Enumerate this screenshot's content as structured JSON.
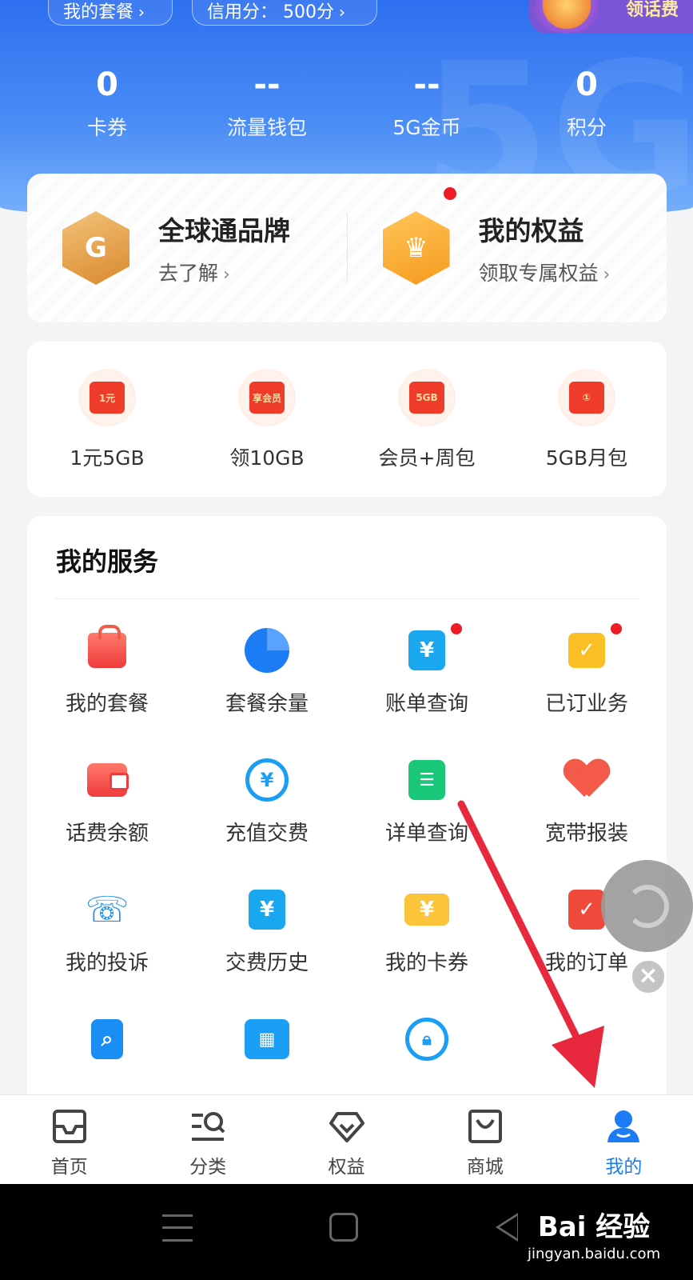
{
  "header": {
    "my_plan": "我的套餐",
    "credit": "信用分： 500分",
    "promo": "领话费",
    "watermark": "5G"
  },
  "stats": [
    {
      "value": "0",
      "label": "卡券"
    },
    {
      "value": "--",
      "label": "流量钱包"
    },
    {
      "value": "--",
      "label": "5G金币"
    },
    {
      "value": "0",
      "label": "积分"
    }
  ],
  "brand": {
    "left": {
      "title": "全球通品牌",
      "sub": "去了解"
    },
    "right": {
      "title": "我的权益",
      "sub": "领取专属权益"
    }
  },
  "quick": [
    {
      "badge": "1元",
      "label": "1元5GB"
    },
    {
      "badge": "享会员",
      "label": "领10GB"
    },
    {
      "badge": "5GB",
      "label": "会员+周包"
    },
    {
      "badge": "①",
      "label": "5GB月包"
    }
  ],
  "services": {
    "title": "我的服务",
    "items": [
      {
        "label": "我的套餐",
        "icon": "bag-icon"
      },
      {
        "label": "套餐余量",
        "icon": "pie-chart-icon"
      },
      {
        "label": "账单查询",
        "icon": "bill-yen-icon"
      },
      {
        "label": "已订业务",
        "icon": "briefcase-check-icon"
      },
      {
        "label": "话费余额",
        "icon": "wallet-icon"
      },
      {
        "label": "充值交费",
        "icon": "yen-refresh-icon"
      },
      {
        "label": "详单查询",
        "icon": "list-icon"
      },
      {
        "label": "宽带报装",
        "icon": "heart-icon"
      },
      {
        "label": "我的投诉",
        "icon": "phone-alert-icon"
      },
      {
        "label": "交费历史",
        "icon": "notebook-yen-icon"
      },
      {
        "label": "我的卡券",
        "icon": "coupon-yen-icon"
      },
      {
        "label": "我的订单",
        "icon": "clipboard-check-icon"
      },
      {
        "label": "",
        "icon": "sim-search-icon"
      },
      {
        "label": "",
        "icon": "store-icon"
      },
      {
        "label": "",
        "icon": "lock-refresh-icon"
      },
      {
        "label": "",
        "icon": "service-icon"
      }
    ]
  },
  "tabs": [
    {
      "label": "首页",
      "icon": "home-icon"
    },
    {
      "label": "分类",
      "icon": "category-search-icon"
    },
    {
      "label": "权益",
      "icon": "diamond-icon"
    },
    {
      "label": "商城",
      "icon": "shopping-bag-icon"
    },
    {
      "label": "我的",
      "icon": "user-icon"
    }
  ],
  "watermark_site": {
    "brand": "Bai 经验",
    "url": "jingyan.baidu.com"
  },
  "colors": {
    "primary_blue": "#1b7cf5",
    "accent_red": "#ef3b2a",
    "annotation_red": "#e8283c"
  }
}
